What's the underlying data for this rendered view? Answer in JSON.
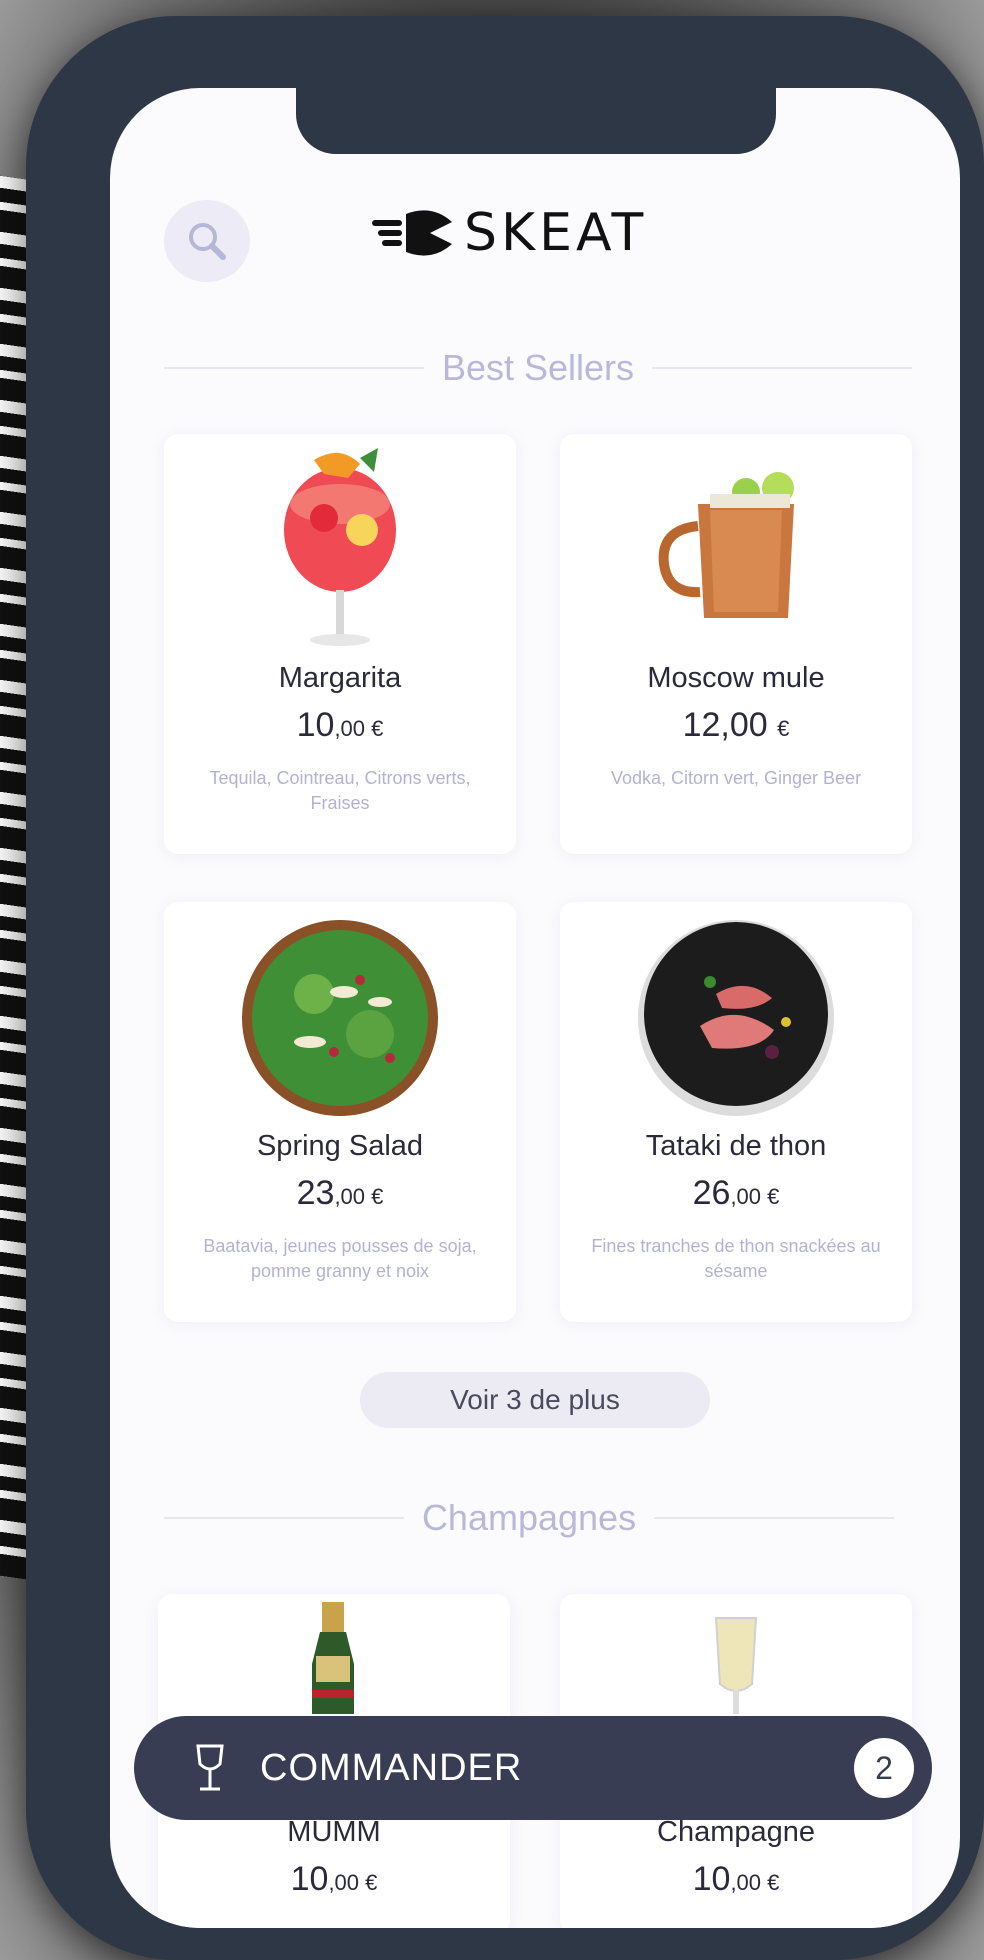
{
  "header": {
    "logo_text": "SKEAT"
  },
  "sections": [
    {
      "title": "Best Sellers"
    },
    {
      "title": "Champagnes"
    }
  ],
  "best_sellers": [
    {
      "name": "Margarita",
      "price_int": "10",
      "price_dec": ",00 €",
      "desc": "Tequila, Cointreau, Citrons verts, Fraises",
      "image": "cocktail-glass-image"
    },
    {
      "name": "Moscow mule",
      "price_int": "12,00",
      "price_dec": "€",
      "desc": "Vodka, Citorn vert, Ginger Beer",
      "image": "copper-mug-image"
    },
    {
      "name": "Spring Salad",
      "price_int": "23",
      "price_dec": ",00 €",
      "desc": "Baatavia, jeunes pousses de soja, pomme granny et noix",
      "image": "salad-bowl-image"
    },
    {
      "name": "Tataki de thon",
      "price_int": "26",
      "price_dec": ",00 €",
      "desc": "Fines tranches de thon snackées au sésame",
      "image": "tuna-plate-image"
    }
  ],
  "see_more_label": "Voir 3 de plus",
  "champagnes": [
    {
      "name": "MUMM",
      "price_int": "10",
      "price_dec": ",00 €",
      "image": "champagne-bottle-image"
    },
    {
      "name": "Champagne",
      "price_int": "10",
      "price_dec": ",00 €",
      "image": "champagne-flute-image"
    }
  ],
  "order_bar": {
    "label": "COMMANDER",
    "count": "2",
    "icon": "wine-glass-icon"
  },
  "colors": {
    "accent_dark": "#393d54",
    "muted_text": "#b3b2d4",
    "section_title": "#b9b8d8",
    "background": "#fbfbfe"
  }
}
